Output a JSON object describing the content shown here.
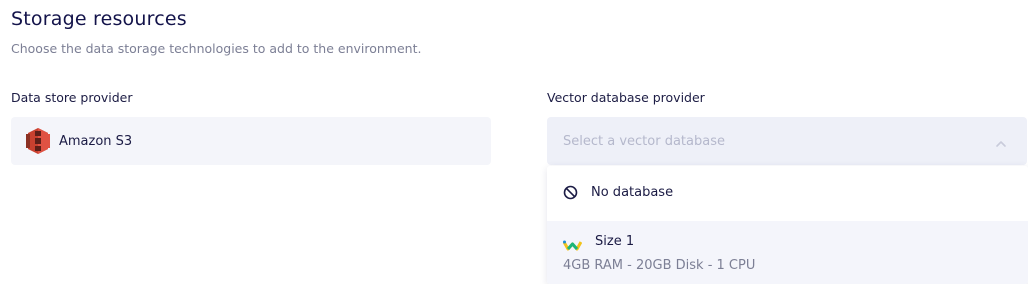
{
  "section": {
    "title": "Storage resources",
    "subtitle": "Choose the data storage technologies to add to the environment."
  },
  "data_store": {
    "label": "Data store provider",
    "selected_value": "Amazon S3",
    "icon": "amazon-s3-icon"
  },
  "vector_db": {
    "label": "Vector database provider",
    "placeholder": "Select a vector database",
    "icon": "chevron-up-icon",
    "options": [
      {
        "label": "No database",
        "icon": "no-database-icon"
      },
      {
        "label": "Size 1",
        "description": "4GB RAM - 20GB Disk - 1 CPU",
        "icon": "size-icon"
      }
    ]
  },
  "colors": {
    "text_primary": "#13134a",
    "text_muted": "#7c7f95",
    "placeholder": "#b5b8cc",
    "input_bg": "#f4f5fa",
    "input_active_bg": "#eef0f8",
    "s3_red": "#c8412f"
  }
}
